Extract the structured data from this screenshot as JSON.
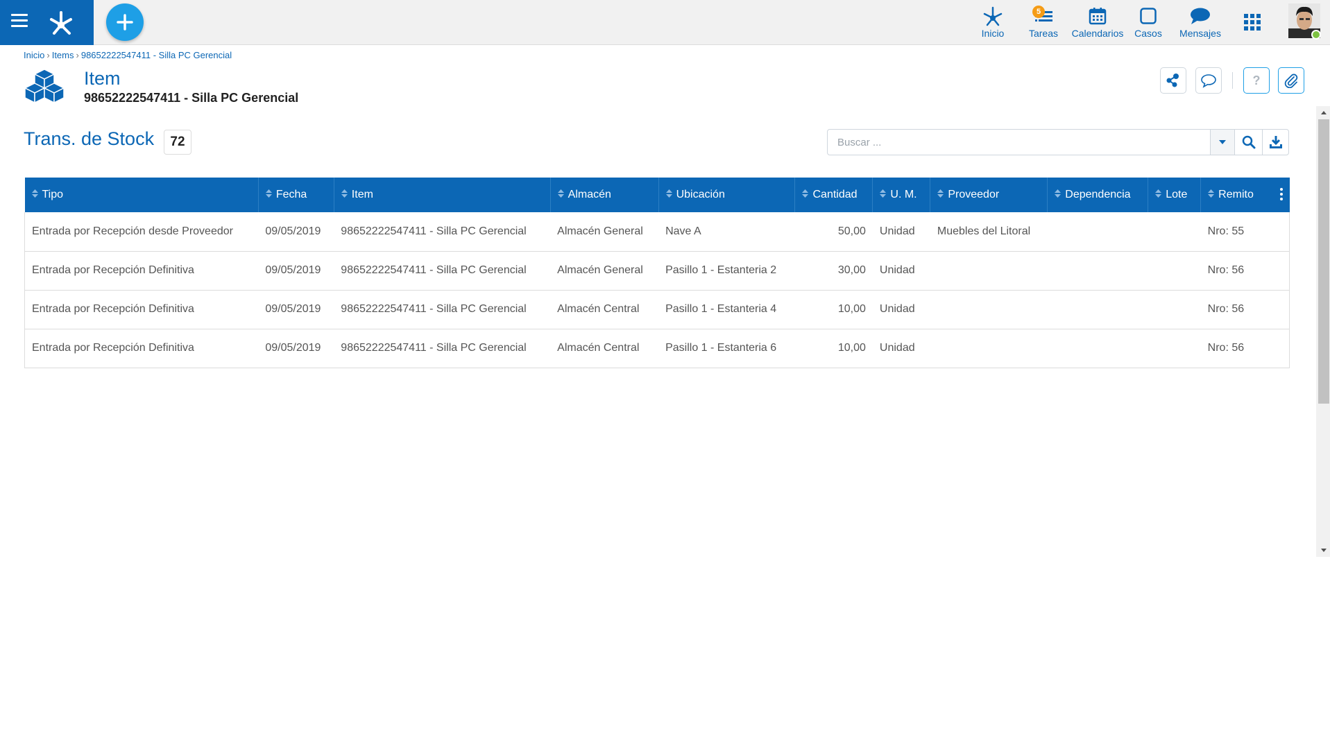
{
  "topbar": {
    "nav": [
      {
        "label": "Inicio",
        "icon": "home-node-icon"
      },
      {
        "label": "Tareas",
        "icon": "tasks-icon",
        "badge": "5"
      },
      {
        "label": "Calendarios",
        "icon": "calendar-icon"
      },
      {
        "label": "Casos",
        "icon": "cases-icon"
      },
      {
        "label": "Mensajes",
        "icon": "messages-icon"
      }
    ],
    "apps_icon": "apps-grid-icon",
    "accent": "#0c67b5",
    "add_color": "#1e9fe6",
    "badge_color": "#f59c16",
    "status_color": "#7dc242"
  },
  "breadcrumb": {
    "items": [
      "Inicio",
      "Items",
      "98652222547411 - Silla PC Gerencial"
    ]
  },
  "header": {
    "title": "Item",
    "subtitle": "98652222547411 - Silla PC Gerencial"
  },
  "section": {
    "title": "Trans. de Stock",
    "count": "72"
  },
  "search": {
    "placeholder": "Buscar ..."
  },
  "table": {
    "columns": [
      "Tipo",
      "Fecha",
      "Item",
      "Almacén",
      "Ubicación",
      "Cantidad",
      "U. M.",
      "Proveedor",
      "Dependencia",
      "Lote",
      "Remito"
    ],
    "rows": [
      [
        "Entrada por Recepción desde Proveedor",
        "09/05/2019",
        "98652222547411 - Silla PC Gerencial",
        "Almacén General",
        "Nave A",
        "50,00",
        "Unidad",
        "Muebles del Litoral",
        "",
        "",
        "Nro: 55"
      ],
      [
        "Entrada por Recepción Definitiva",
        "09/05/2019",
        "98652222547411 - Silla PC Gerencial",
        "Almacén General",
        "Pasillo 1 - Estanteria 2",
        "30,00",
        "Unidad",
        "",
        "",
        "",
        "Nro: 56"
      ],
      [
        "Entrada por Recepción Definitiva",
        "09/05/2019",
        "98652222547411 - Silla PC Gerencial",
        "Almacén Central",
        "Pasillo 1 - Estanteria 4",
        "10,00",
        "Unidad",
        "",
        "",
        "",
        "Nro: 56"
      ],
      [
        "Entrada por Recepción Definitiva",
        "09/05/2019",
        "98652222547411 - Silla PC Gerencial",
        "Almacén Central",
        "Pasillo 1 - Estanteria 6",
        "10,00",
        "Unidad",
        "",
        "",
        "",
        "Nro: 56"
      ]
    ]
  }
}
